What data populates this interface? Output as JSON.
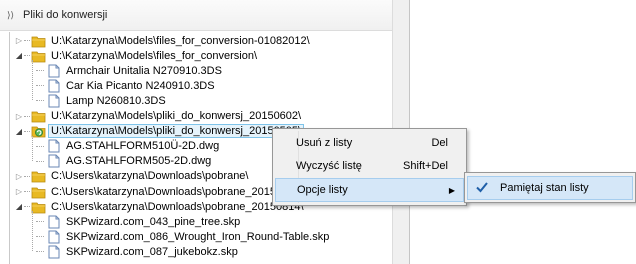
{
  "panel": {
    "title": "Pliki do konwersji"
  },
  "tree": {
    "rows": [
      {
        "label": "U:\\Katarzyna\\Models\\files_for_conversion-01082012\\",
        "kind": "folder",
        "expanded": false,
        "level": 0
      },
      {
        "label": "U:\\Katarzyna\\Models\\files_for_conversion\\",
        "kind": "folder",
        "expanded": true,
        "level": 0
      },
      {
        "label": "Armchair Unitalia N270910.3DS",
        "kind": "file",
        "level": 1
      },
      {
        "label": "Car Kia Picanto N240910.3DS",
        "kind": "file",
        "level": 1
      },
      {
        "label": "Lamp N260810.3DS",
        "kind": "file",
        "level": 1
      },
      {
        "label": "U:\\Katarzyna\\Models\\pliki_do_konwersj_20150602\\",
        "kind": "folder",
        "expanded": false,
        "level": 0
      },
      {
        "label": "U:\\Katarzyna\\Models\\pliki_do_konwersj_20150505\\",
        "kind": "folder-refresh",
        "expanded": true,
        "level": 0,
        "selected": true
      },
      {
        "label": "AG.STAHLFORM510Ü-2D.dwg",
        "kind": "file",
        "level": 1
      },
      {
        "label": "AG.STAHLFORM505-2D.dwg",
        "kind": "file",
        "level": 1
      },
      {
        "label": "C:\\Users\\katarzyna\\Downloads\\pobrane\\",
        "kind": "folder",
        "expanded": false,
        "level": 0
      },
      {
        "label": "C:\\Users\\katarzyna\\Downloads\\pobrane_20150",
        "kind": "folder",
        "expanded": false,
        "level": 0
      },
      {
        "label": "C:\\Users\\katarzyna\\Downloads\\pobrane_20150814\\",
        "kind": "folder",
        "expanded": true,
        "level": 0
      },
      {
        "label": "SKPwizard.com_043_pine_tree.skp",
        "kind": "file",
        "level": 1
      },
      {
        "label": "SKPwizard.com_086_Wrought_Iron_Round-Table.skp",
        "kind": "file",
        "level": 1
      },
      {
        "label": "SKPwizard.com_087_jukebokz.skp",
        "kind": "file",
        "level": 1
      }
    ]
  },
  "context_menu": {
    "items": [
      {
        "label": "Usuń z listy",
        "shortcut": "Del"
      },
      {
        "label": "Wyczyść listę",
        "shortcut": "Shift+Del"
      },
      {
        "label": "Opcje listy",
        "shortcut": "",
        "has_submenu": true
      }
    ]
  },
  "submenu": {
    "items": [
      {
        "label": "Pamiętaj stan listy",
        "checked": true
      }
    ]
  },
  "colors": {
    "folder": "#e8b923",
    "hover": "#d5e7f8",
    "selection_border": "#7fc4ea",
    "check": "#1f5fa8"
  }
}
